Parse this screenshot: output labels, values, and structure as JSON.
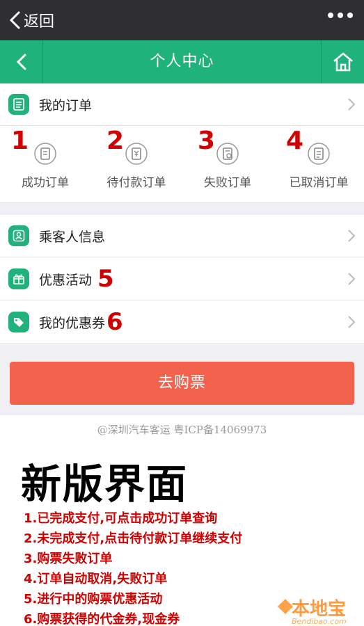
{
  "wechat_bar": {
    "back_label": "返回"
  },
  "header": {
    "title": "个人中心"
  },
  "orders": {
    "title": "我的订单",
    "items": [
      {
        "num": "1",
        "label": "成功订单"
      },
      {
        "num": "2",
        "label": "待付款订单"
      },
      {
        "num": "3",
        "label": "失败订单"
      },
      {
        "num": "4",
        "label": "已取消订单"
      }
    ]
  },
  "menu": {
    "items": [
      {
        "label": "乘客人信息",
        "num": ""
      },
      {
        "label": "优惠活动",
        "num": "5"
      },
      {
        "label": "我的优惠券",
        "num": "6"
      }
    ]
  },
  "buy_button": "去购票",
  "footer": "@深圳汽车客运 粤ICP备14069973",
  "annotation": {
    "title": "新版界面",
    "notes": [
      "1.已完成支付,可点击成功订单查询",
      "2.未完成支付,点击待付款订单继续支付",
      "3.购票失败订单",
      "4.订单自动取消,失败订单",
      "5.进行中的购票优惠活动",
      "6.购票获得的代金券,现金券"
    ]
  },
  "watermark": {
    "name": "本地宝",
    "url": "Bendibao.com"
  },
  "colors": {
    "brand_green": "#1fb27b",
    "buy_orange": "#f3624d",
    "annotation_red": "#d10000",
    "wechat_dark": "#2e2e33"
  }
}
